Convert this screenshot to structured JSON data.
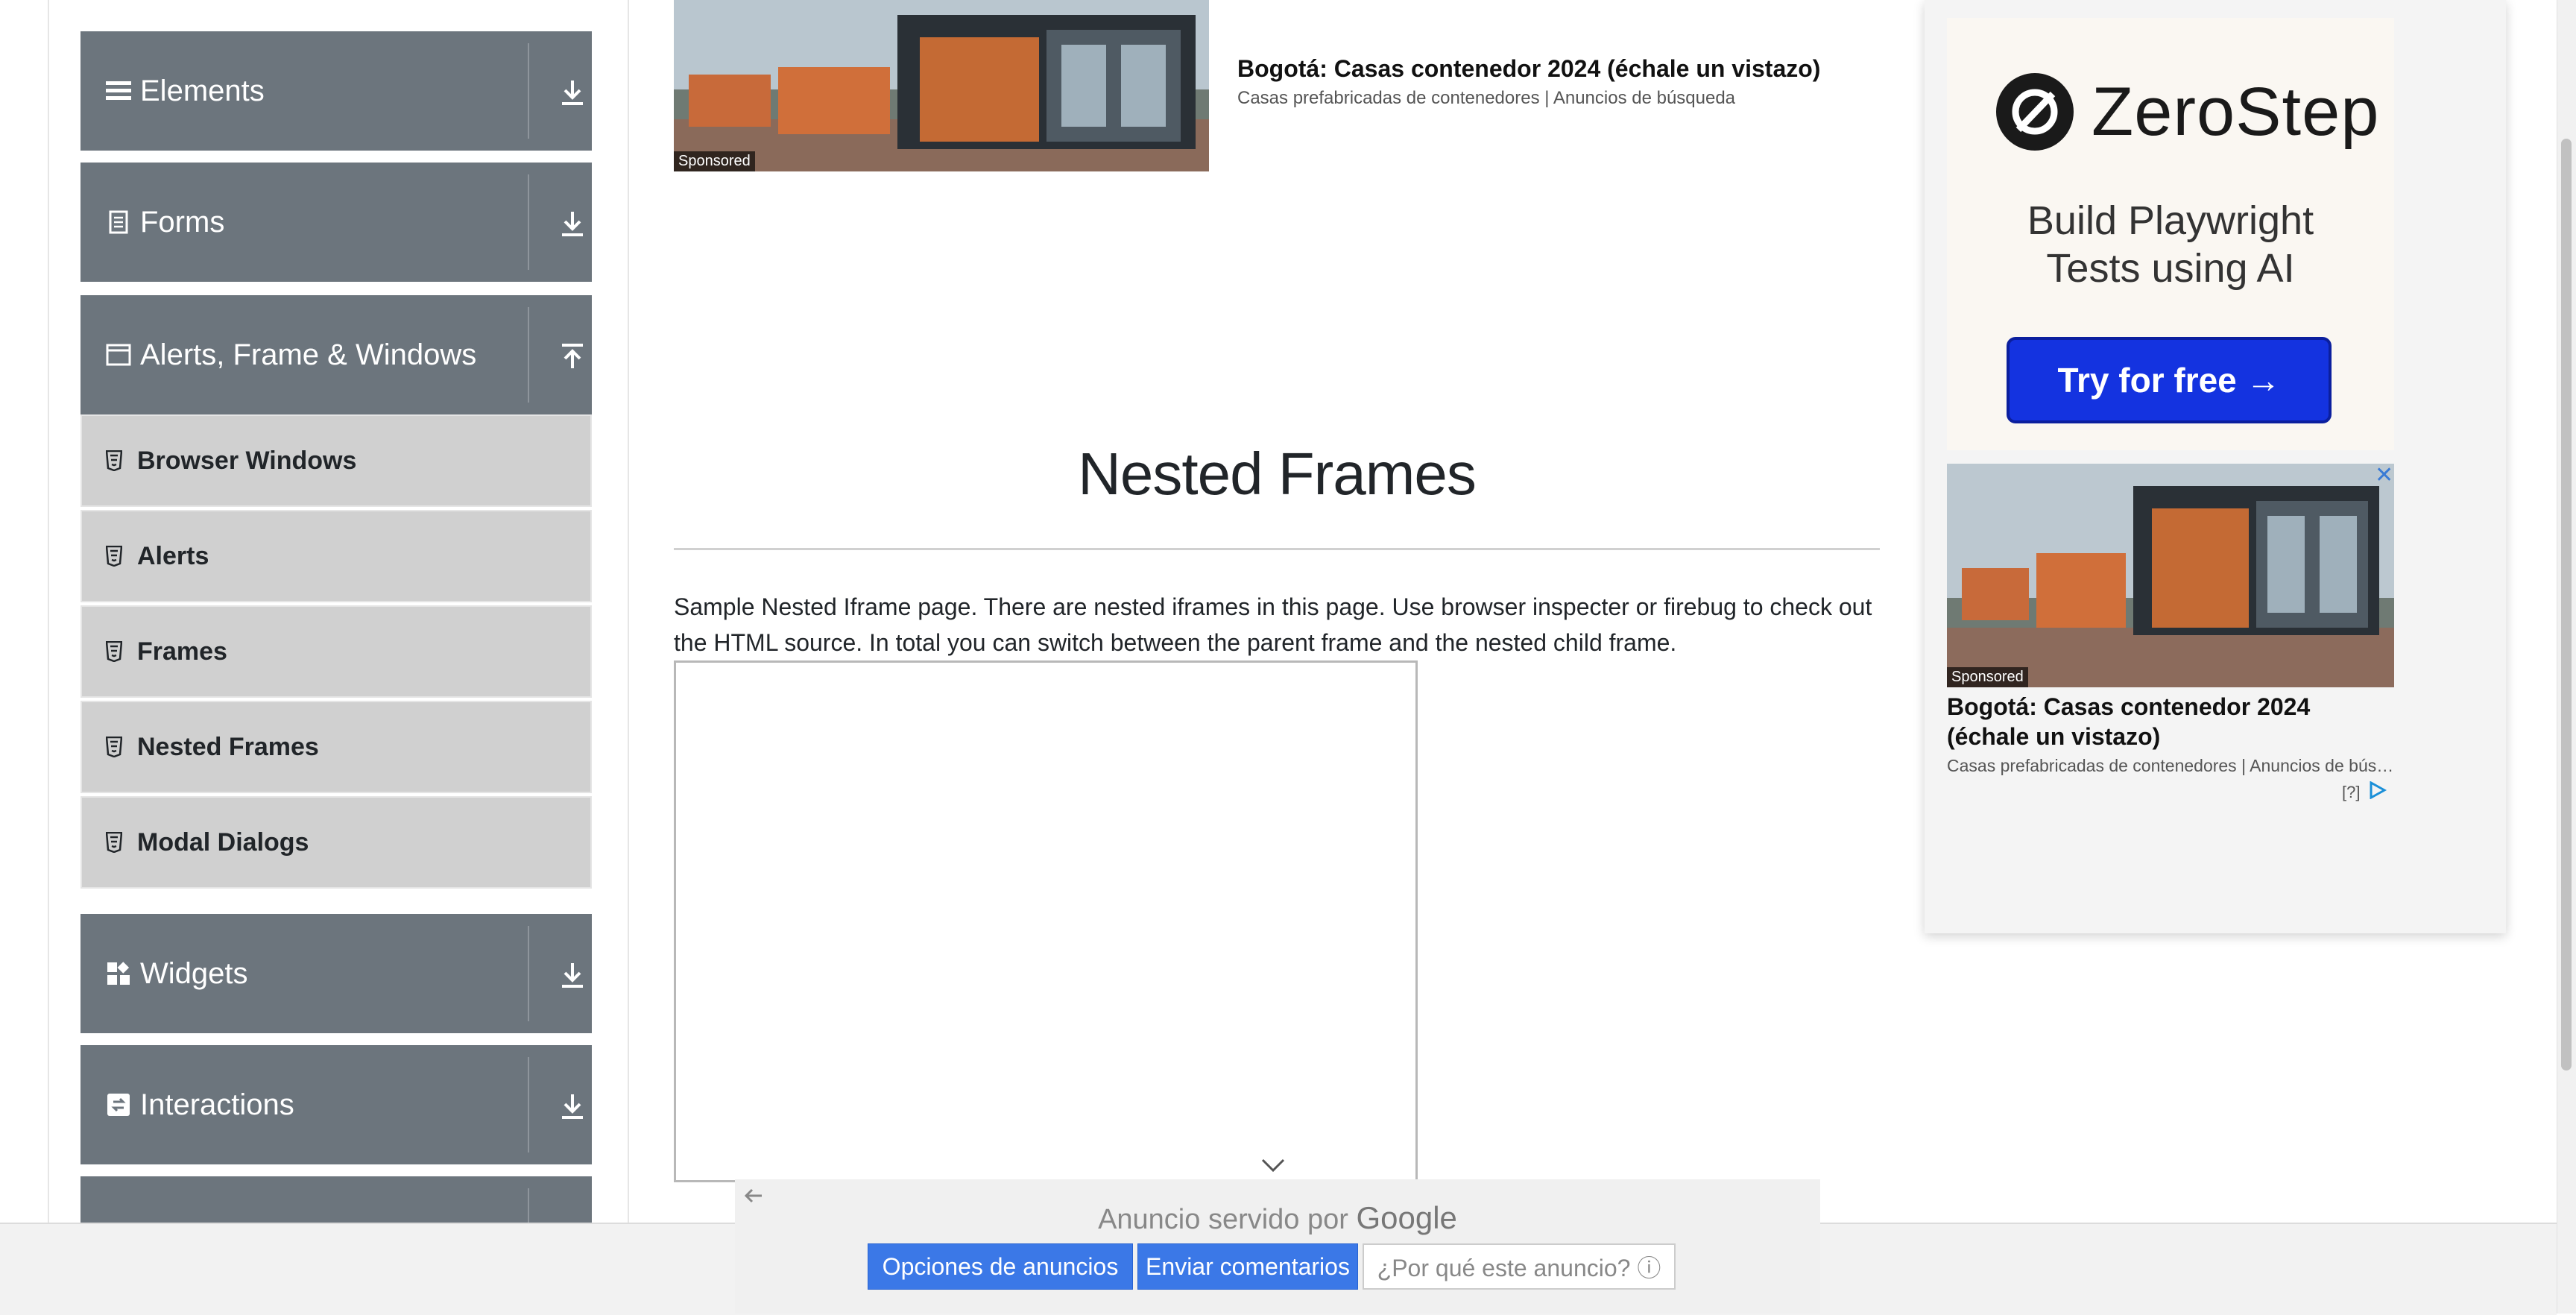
{
  "sidebar": {
    "groups": [
      {
        "label": "Elements",
        "icon": "list-icon",
        "arrow": "download-arrow-icon"
      },
      {
        "label": "Forms",
        "icon": "form-icon",
        "arrow": "download-arrow-icon"
      },
      {
        "label": "Alerts, Frame & Windows",
        "icon": "window-icon",
        "arrow": "upload-arrow-icon"
      },
      {
        "label": "Widgets",
        "icon": "widgets-icon",
        "arrow": "download-arrow-icon"
      },
      {
        "label": "Interactions",
        "icon": "interactions-icon",
        "arrow": "download-arrow-icon"
      }
    ],
    "sub_items": [
      "Browser Windows",
      "Alerts",
      "Frames",
      "Nested Frames",
      "Modal Dialogs"
    ]
  },
  "top_ad": {
    "sponsored": "Sponsored",
    "title": "Bogotá: Casas contenedor 2024 (échale un vistazo)",
    "subtitle": "Casas prefabricadas de contenedores | Anuncios de búsqueda"
  },
  "main": {
    "title": "Nested Frames",
    "description": "Sample Nested Iframe page. There are nested iframes in this page. Use browser inspecter or firebug to check out the HTML source. In total you can switch between the parent frame and the nested child frame."
  },
  "right_ad": {
    "brand": "ZeroStep",
    "headline_1": "Build Playwright",
    "headline_2": "Tests using AI",
    "cta": "Try for free →",
    "sponsored": "Sponsored",
    "title": "Bogotá: Casas contenedor 2024 (échale un vistazo)",
    "subtitle": "Casas prefabricadas de contenedores | Anuncios de búsqueda",
    "help": "[?]"
  },
  "anchor_ad": {
    "served_by": "Anuncio servido por",
    "google": "Google",
    "options": "Opciones de anuncios",
    "feedback": "Enviar comentarios",
    "why": "¿Por qué este anuncio? ⓘ"
  },
  "colors": {
    "sidebar_header": "#6c757d",
    "sidebar_item": "#d0d0d0",
    "cta_blue": "#1433e0",
    "ad_button_blue": "#3b78e7"
  }
}
